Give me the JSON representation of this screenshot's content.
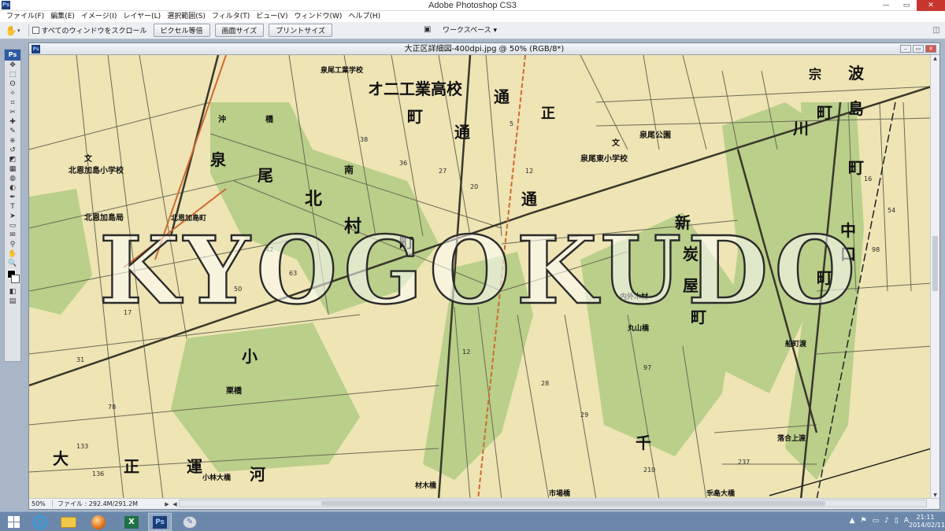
{
  "app": {
    "title": "Adobe Photoshop CS3",
    "logo": "Ps"
  },
  "window_controls": {
    "minimize": "—",
    "restore": "▭",
    "close": "✕"
  },
  "menubar": [
    "ファイル(F)",
    "編集(E)",
    "イメージ(I)",
    "レイヤー(L)",
    "選択範囲(S)",
    "フィルタ(T)",
    "ビュー(V)",
    "ウィンドウ(W)",
    "ヘルプ(H)"
  ],
  "options_bar": {
    "scroll_all_label": "すべてのウィンドウをスクロール",
    "btn_actual_pixels": "ピクセル等倍",
    "btn_fit_screen": "画面サイズ",
    "btn_print_size": "プリントサイズ",
    "workspace_label": "ワークスペース ▾"
  },
  "toolbox": {
    "header": "Ps",
    "tools": [
      "move-tool",
      "marquee-tool",
      "lasso-tool",
      "magic-wand-tool",
      "crop-tool",
      "slice-tool",
      "healing-tool",
      "brush-tool",
      "clone-stamp-tool",
      "history-brush-tool",
      "eraser-tool",
      "gradient-tool",
      "blur-tool",
      "dodge-tool",
      "pen-tool",
      "type-tool",
      "path-selection-tool",
      "shape-tool",
      "notes-tool",
      "eyedropper-tool",
      "hand-tool",
      "zoom-tool"
    ],
    "glyphs": [
      "✥",
      "⬚",
      "ʘ",
      "✧",
      "⌗",
      "✂",
      "✚",
      "✎",
      "⎈",
      "↺",
      "◩",
      "▦",
      "◍",
      "◐",
      "✒",
      "T",
      "➤",
      "▭",
      "✉",
      "⚲",
      "✋",
      "🔍"
    ]
  },
  "document": {
    "title": "大正区詳細図-400dpi.jpg @ 50% (RGB/8*)",
    "zoom": "50%",
    "file_info": "ファイル : 292.4M/291.2M",
    "watermark": "KYOGOKUDO",
    "map_labels": [
      "泉尾工業学校",
      "オ二工業高校",
      "町",
      "通",
      "通",
      "正",
      "泉尾公園",
      "文",
      "泉尾東小学校",
      "泉",
      "尾",
      "南",
      "北",
      "村",
      "町",
      "通",
      "新",
      "炭",
      "屋",
      "町",
      "内外木材",
      "丸山橋",
      "北恩加島小学校",
      "文",
      "北恩加島局",
      "北恩加島町",
      "沖",
      "橋",
      "小",
      "栗橋",
      "大",
      "正",
      "運",
      "河",
      "小林大橋",
      "千",
      "市場橋",
      "千島大橋",
      "材木橋",
      "落合上渡",
      "船町渡",
      "宗",
      "波",
      "島",
      "町",
      "川",
      "町",
      "中",
      "口",
      "町"
    ]
  },
  "taskbar": {
    "apps": [
      "start-button",
      "internet-explorer",
      "file-explorer",
      "browser-orb",
      "excel",
      "photoshop",
      "paint"
    ],
    "tray": [
      "▲",
      "⚑",
      "▭",
      "♪",
      "▯",
      "A"
    ],
    "clock_time": "21:11",
    "clock_date": "2014/02/11"
  },
  "colors": {
    "map_paper": "#eee4b4",
    "map_green": "#b9cf8a",
    "map_road": "#6c6a55",
    "map_orange": "#d06a30",
    "taskbar": "#6b88ab",
    "ps_blue": "#1c3f7a"
  }
}
